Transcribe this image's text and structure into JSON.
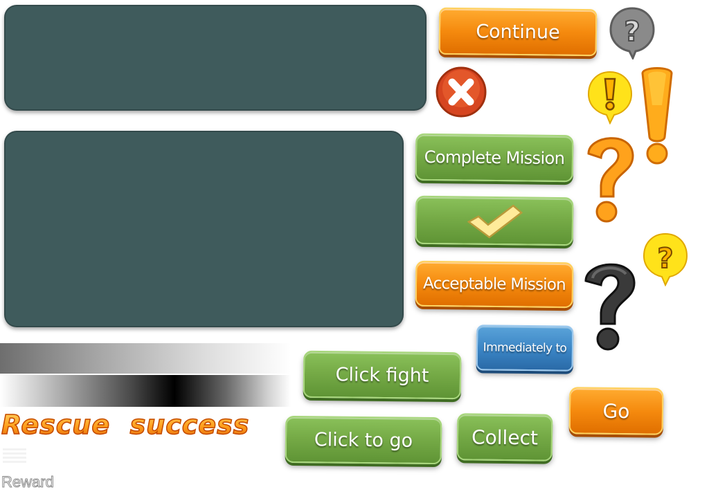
{
  "buttons": {
    "continue": "Continue",
    "complete_mission": "Complete Mission",
    "acceptable_mission": "Acceptable Mission",
    "immediately_to": "Immediately to",
    "click_fight": "Click fight",
    "click_to_go": "Click to go",
    "collect": "Collect",
    "go": "Go"
  },
  "texts": {
    "rescue_success": "Rescue  success",
    "reward": "Reward"
  },
  "icons": {
    "question_gray": "question-bubble-gray-icon",
    "close": "close-x-icon",
    "exclaim_bubble": "exclamation-bubble-yellow-icon",
    "exclaim_big": "exclamation-large-orange-icon",
    "question_orange": "question-large-orange-icon",
    "checkmark": "checkmark-icon",
    "question_bubble_yellow": "question-bubble-yellow-icon",
    "question_black": "question-large-black-icon"
  },
  "colors": {
    "panel": "#3f5b5c",
    "green": "#76ab47",
    "orange": "#f58a0e",
    "blue": "#3a84c4"
  }
}
